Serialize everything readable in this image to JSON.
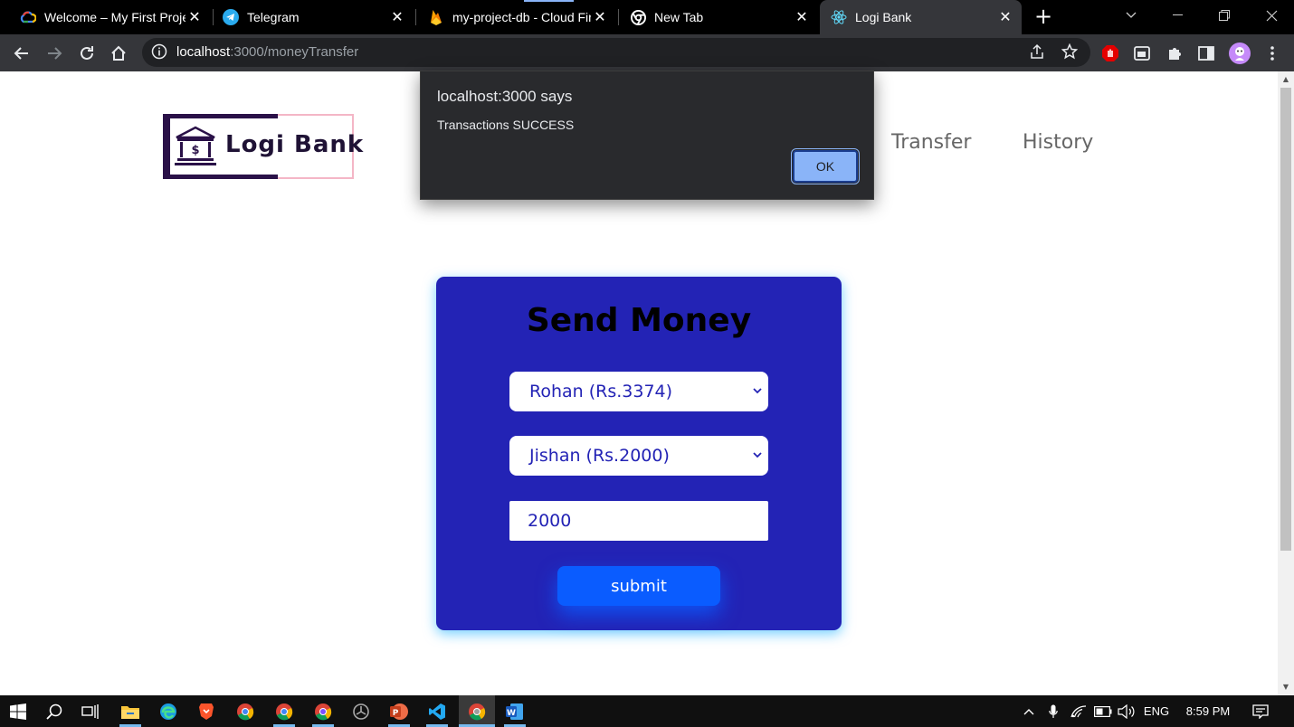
{
  "browser": {
    "tabs": [
      {
        "title": "Welcome – My First Proje",
        "icon": "google-cloud-icon",
        "active": false
      },
      {
        "title": "Telegram",
        "icon": "telegram-icon",
        "active": false
      },
      {
        "title": "my-project-db - Cloud Fir",
        "icon": "firebase-icon",
        "active": false
      },
      {
        "title": "New Tab",
        "icon": "chrome-icon",
        "active": false
      },
      {
        "title": "Logi Bank",
        "icon": "react-icon",
        "active": true
      }
    ],
    "close_glyph": "✕",
    "new_tab_glyph": "+",
    "url_host": "localhost",
    "url_path": ":3000/moneyTransfer"
  },
  "page": {
    "logo_text": "Logi Bank",
    "nav": {
      "transfer": "Transfer",
      "history": "History"
    },
    "form": {
      "title": "Send Money",
      "from_selected": "Rohan (Rs.3374)",
      "to_selected": "Jishan (Rs.2000)",
      "amount": "2000",
      "submit_label": "submit"
    }
  },
  "dialog": {
    "title": "localhost:3000 says",
    "message": "Transactions SUCCESS",
    "ok_label": "OK"
  },
  "taskbar": {
    "language": "ENG",
    "time": "8:59 PM"
  },
  "colors": {
    "card_bg": "#2323b5",
    "submit_bg": "#0a5cff",
    "dialog_bg": "#292a2d",
    "ok_button": "#8ab4f8",
    "logo_border": "#f4b6c6",
    "logo_dark": "#2a1148"
  }
}
